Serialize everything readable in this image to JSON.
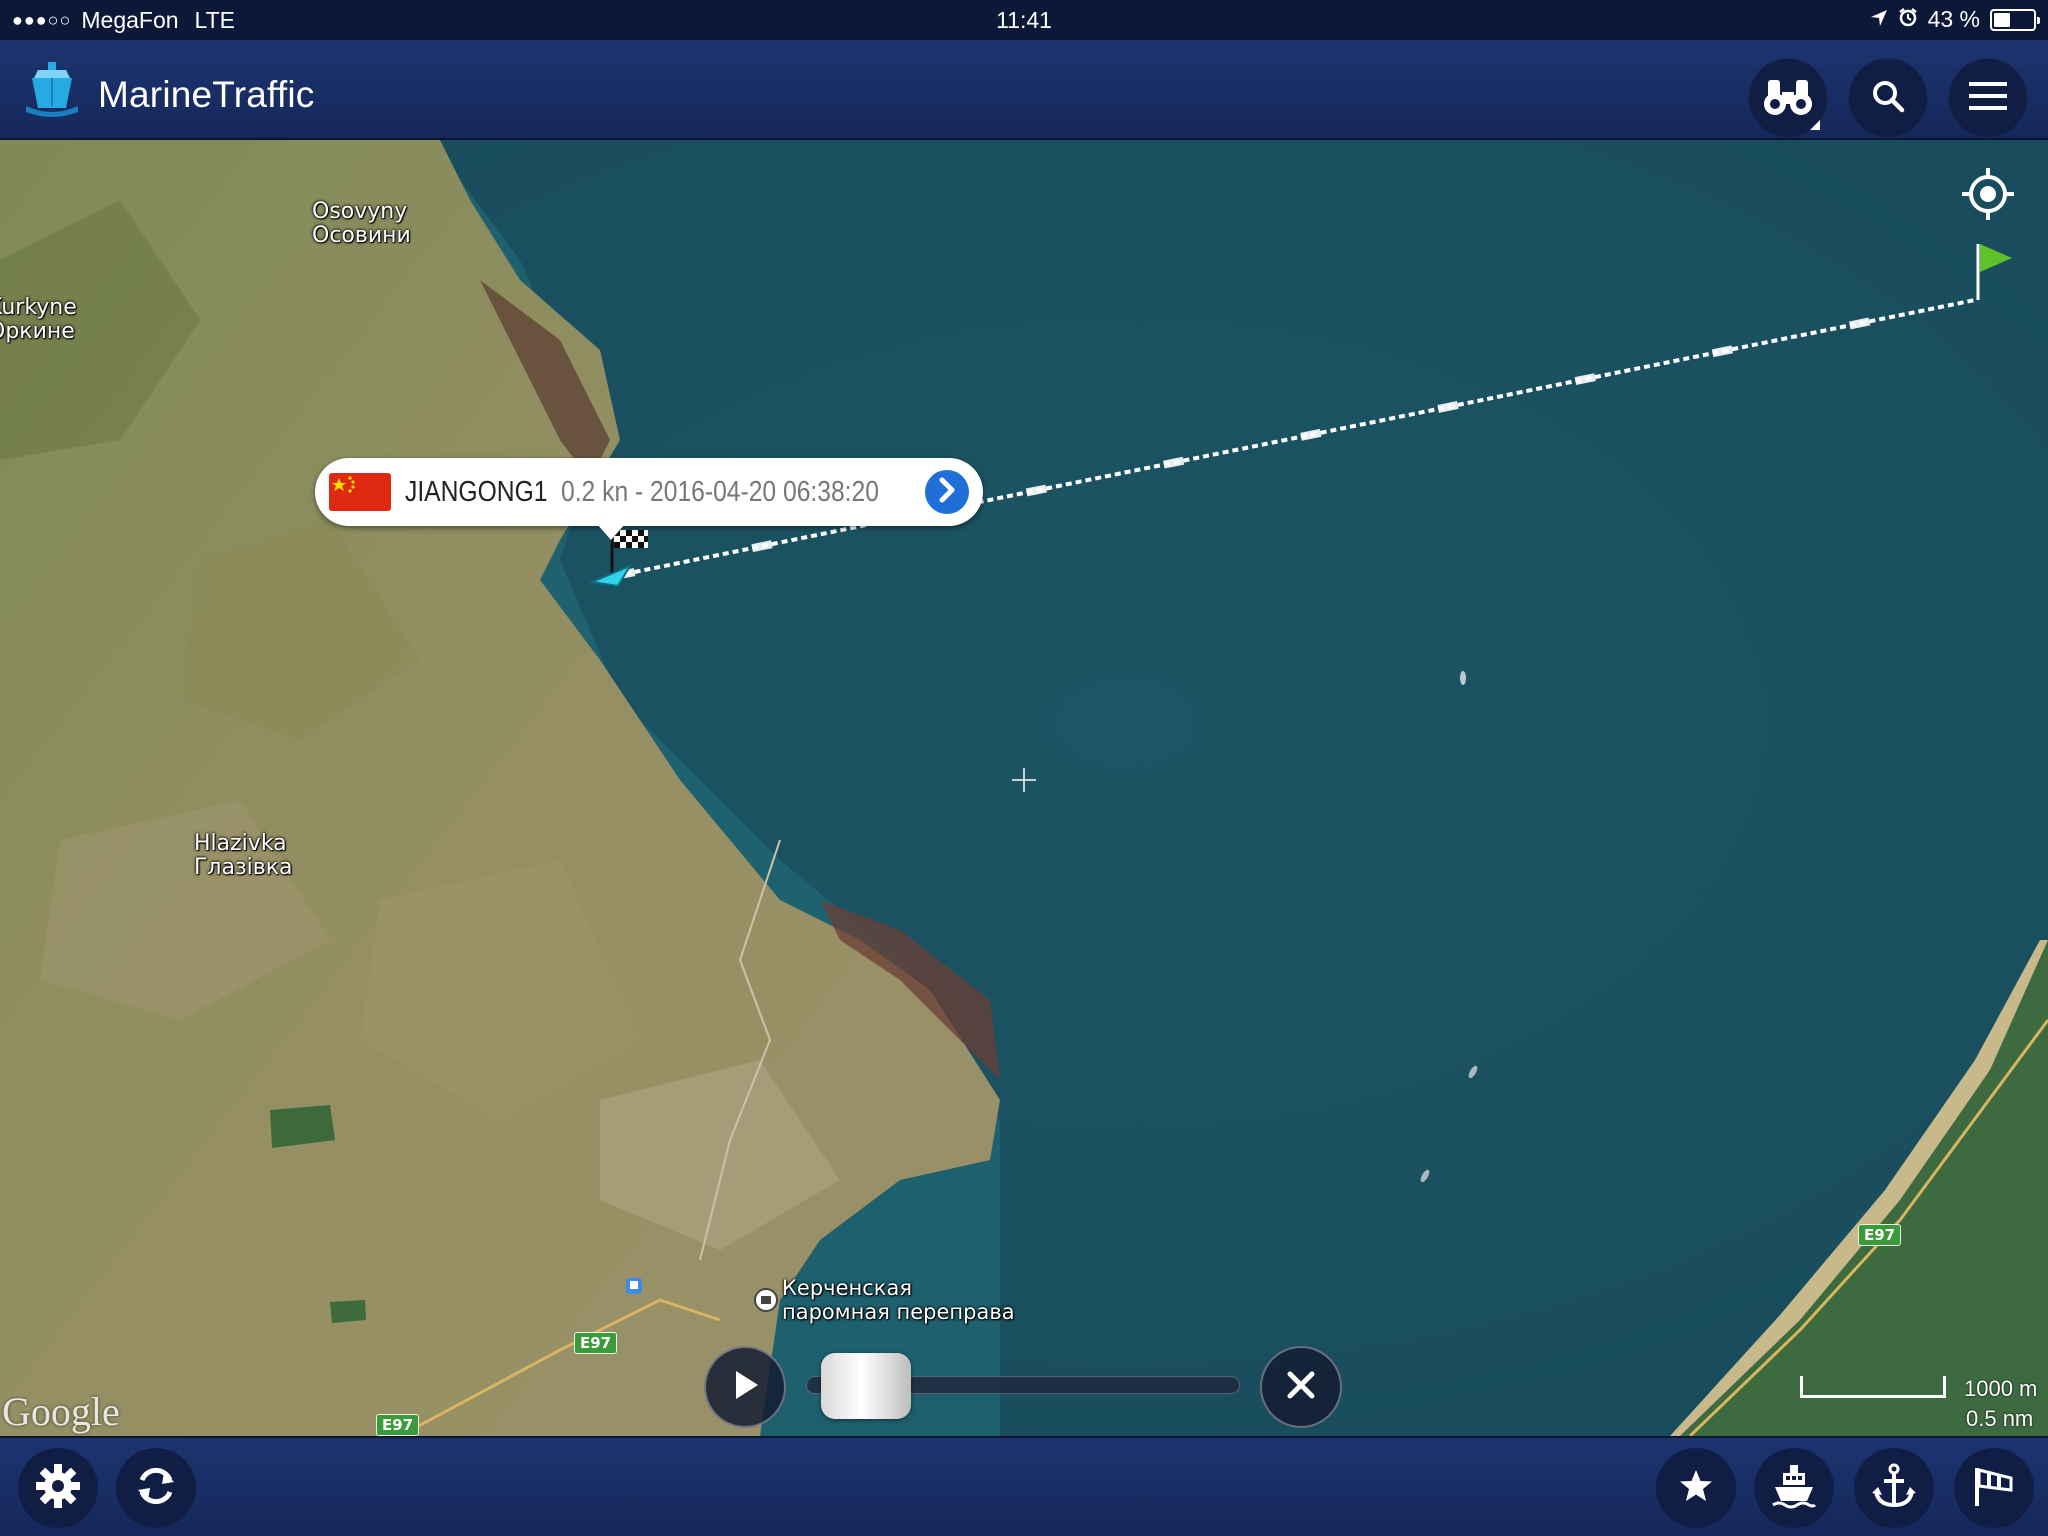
{
  "status_bar": {
    "signal": "●●●○○",
    "carrier": "MegaFon",
    "network": "LTE",
    "time": "11:41",
    "battery_text": "43 %",
    "battery_level": 0.43
  },
  "header": {
    "title": "MarineTraffic",
    "buttons": [
      "binoculars-icon",
      "search-icon",
      "hamburger-menu-icon"
    ]
  },
  "map": {
    "places": {
      "osovyny_lat": "Osovyny",
      "osovyny_cyr": "Осовини",
      "kurkyne_lat": "Kurkyne",
      "kurkyne_cyr": "Оркине",
      "hlazivka_lat": "Hlazivka",
      "hlazivka_cyr": "Глазівка",
      "ferry_line1": "Керченская",
      "ferry_line2": "паромная переправа"
    },
    "road_label": "E97",
    "attribution": "Google",
    "vessel": {
      "flag": "China",
      "name": "JIANGONG1",
      "info": "0.2 kn - 2016-04-20 06:38:20"
    },
    "scale": {
      "metric": "1000 m",
      "nautical": "0.5 nm"
    },
    "playback": {
      "progress": 0.05
    }
  },
  "toolbar": {
    "left": [
      "settings-icon",
      "refresh-icon"
    ],
    "right": [
      "star-icon",
      "ship-icon",
      "anchor-icon",
      "windsock-icon"
    ]
  },
  "colors": {
    "header_bg": "#1d3470",
    "sea": "#1d5a68",
    "land": "#8f8c5f",
    "accent_blue": "#1e6fd8",
    "flag_red": "#de2910",
    "track_white": "#ffffff"
  }
}
